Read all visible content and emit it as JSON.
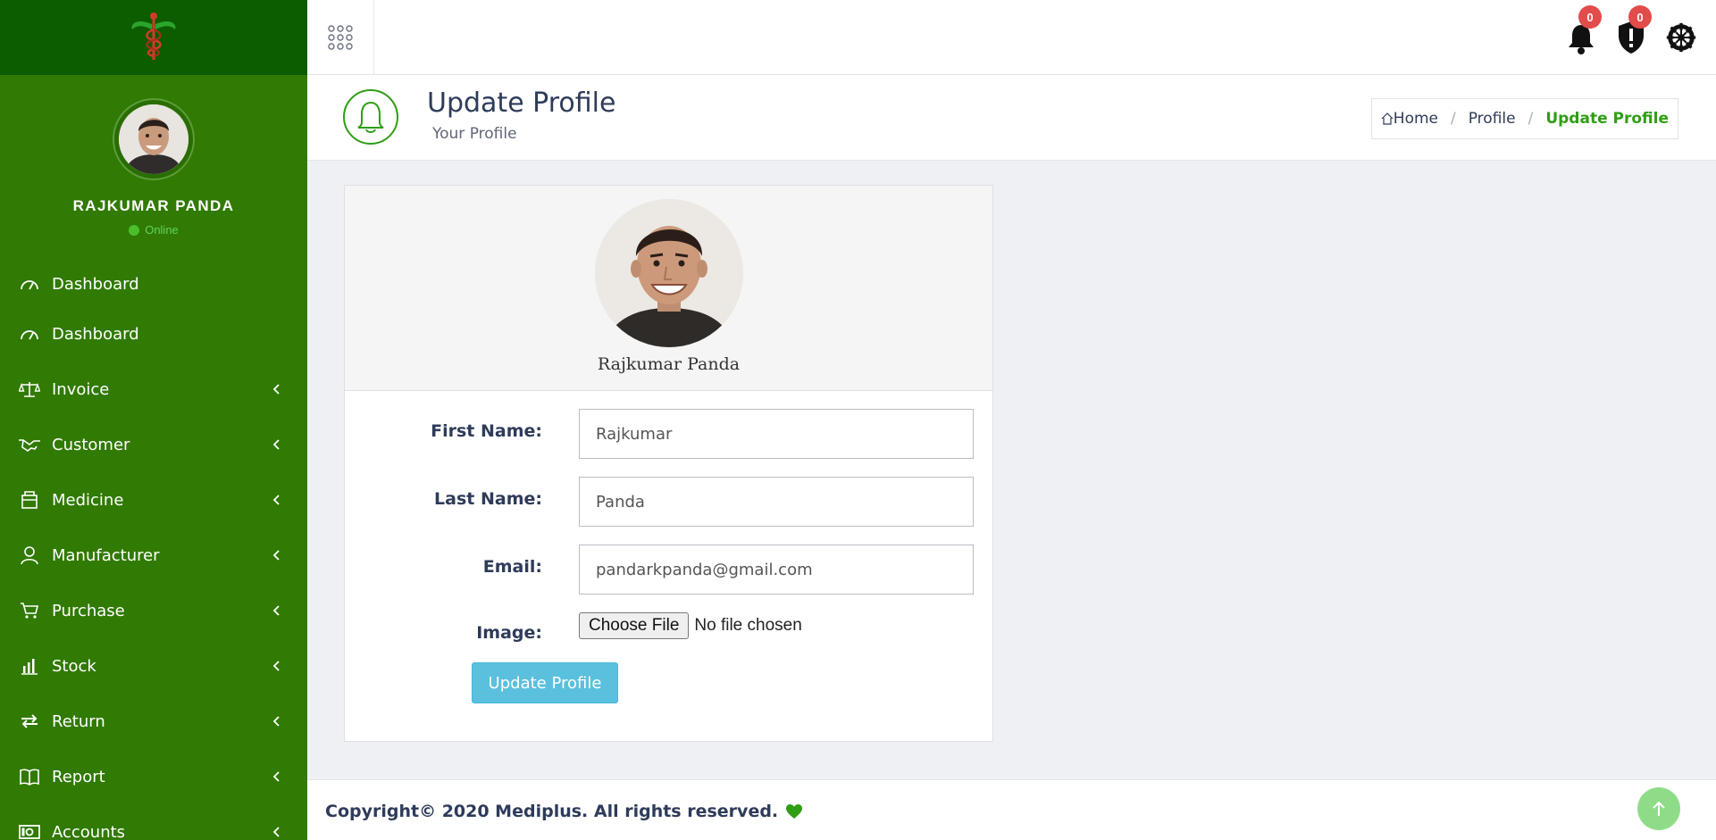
{
  "user": {
    "name": "RAJKUMAR PANDA",
    "status": "Online"
  },
  "sidebar": {
    "ghost_label": "Dashboard",
    "items": [
      {
        "label": "Dashboard",
        "icon": "gauge-icon",
        "has_children": false
      },
      {
        "label": "Invoice",
        "icon": "scale-icon",
        "has_children": true
      },
      {
        "label": "Customer",
        "icon": "handshake-icon",
        "has_children": true
      },
      {
        "label": "Medicine",
        "icon": "box-icon",
        "has_children": true
      },
      {
        "label": "Manufacturer",
        "icon": "user-icon",
        "has_children": true
      },
      {
        "label": "Purchase",
        "icon": "cart-icon",
        "has_children": true
      },
      {
        "label": "Stock",
        "icon": "bar-chart-icon",
        "has_children": true
      },
      {
        "label": "Return",
        "icon": "exchange-icon",
        "has_children": true
      },
      {
        "label": "Report",
        "icon": "book-icon",
        "has_children": true
      },
      {
        "label": "Accounts",
        "icon": "money-icon",
        "has_children": true
      }
    ]
  },
  "topbar": {
    "notifications_count": "0",
    "alerts_count": "0",
    "icons": [
      "apps-grid-icon",
      "bell-icon",
      "shield-alert-icon",
      "settings-wheel-icon"
    ]
  },
  "page_header": {
    "title": "Update Profile",
    "subtitle": "Your Profile",
    "breadcrumb": {
      "home": "Home",
      "middle": "Profile",
      "current": "Update Profile"
    }
  },
  "profile": {
    "display_name": "Rajkumar Panda",
    "form": {
      "first_name_label": "First Name:",
      "first_name": "Rajkumar",
      "last_name_label": "Last Name:",
      "last_name": "Panda",
      "email_label": "Email:",
      "email": "pandarkpanda@gmail.com",
      "image_label": "Image:",
      "file_button": "Choose File",
      "file_status": "No file chosen",
      "submit": "Update Profile"
    }
  },
  "footer": {
    "copyright": "Copyright© 2020 Mediplus. All rights reserved."
  },
  "colors": {
    "sidebar_bg": "#317a03",
    "logo_bg": "#0c5c00",
    "accent_green": "#2f9e14",
    "submit_blue": "#5bc0de",
    "badge_red": "#e24c4b",
    "to_top_green": "#8fdc88"
  }
}
